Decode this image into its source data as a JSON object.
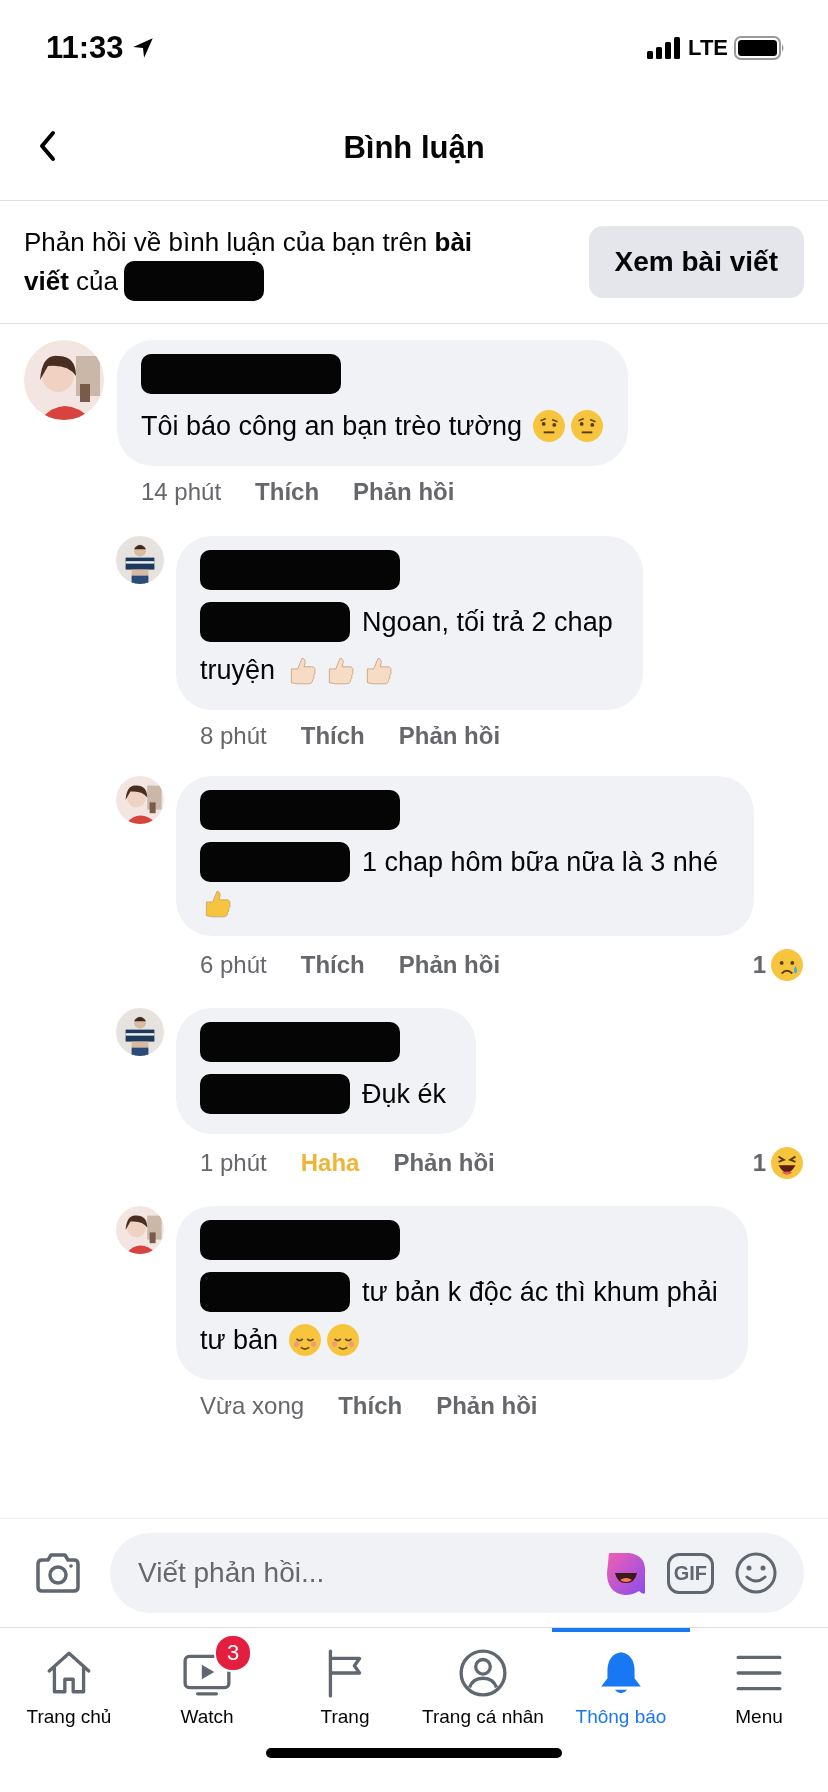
{
  "status_bar": {
    "time": "11:33",
    "network": "LTE"
  },
  "header": {
    "title": "Bình luận"
  },
  "banner": {
    "lines": [
      "Phản hồi về bình luận của bạn trên **bài**",
      "**viết** của"
    ],
    "button": "Xem bài viết"
  },
  "comments": [
    {
      "lines": [
        "Tôi báo công an bạn trèo tường"
      ],
      "emojis": [
        {
          "kind": "skeptical"
        },
        {
          "kind": "skeptical"
        }
      ],
      "tagged": false,
      "time": "14 phút",
      "like": "Thích",
      "reacted": false,
      "reply": "Phản hồi",
      "children": [
        {
          "lines": [
            "Ngoan, tối trả 2 chap",
            "truyện"
          ],
          "emojis": [
            {
              "kind": "thumbs_light"
            },
            {
              "kind": "thumbs_light"
            },
            {
              "kind": "thumbs_light"
            }
          ],
          "tagged": true,
          "time": "8 phút",
          "like": "Thích",
          "reacted": false,
          "reply": "Phản hồi"
        },
        {
          "lines": [
            "1 chap hôm bữa nữa là 3 nhé"
          ],
          "emojis": [
            {
              "kind": "thumbs"
            }
          ],
          "tagged": true,
          "time": "6 phút",
          "like": "Thích",
          "reacted": false,
          "reply": "Phản hồi",
          "reaction": {
            "count": "1",
            "kind": "sad"
          }
        },
        {
          "lines": [
            "Đụk ék"
          ],
          "tagged": true,
          "time": "1 phút",
          "like": "Haha",
          "reacted": true,
          "reply": "Phản hồi",
          "reaction": {
            "count": "1",
            "kind": "haha"
          }
        },
        {
          "lines": [
            "tư bản k độc ác thì khum phải",
            "tư bản"
          ],
          "emojis": [
            {
              "kind": "relieved"
            },
            {
              "kind": "relieved"
            }
          ],
          "tagged": true,
          "time": "Vừa xong",
          "like": "Thích",
          "reacted": false,
          "reply": "Phản hồi"
        }
      ]
    }
  ],
  "composer": {
    "placeholder": "Viết phản hồi...",
    "gif": "GIF"
  },
  "tabs": [
    {
      "label": "Trang chủ",
      "kind": "home",
      "selected": false
    },
    {
      "label": "Watch",
      "kind": "watch",
      "selected": false,
      "badge": "3"
    },
    {
      "label": "Trang",
      "kind": "flag",
      "selected": false
    },
    {
      "label": "Trang cá nhân",
      "kind": "profile",
      "selected": false
    },
    {
      "label": "Thông báo",
      "kind": "bell",
      "selected": true
    },
    {
      "label": "Menu",
      "kind": "menu",
      "selected": false
    }
  ]
}
